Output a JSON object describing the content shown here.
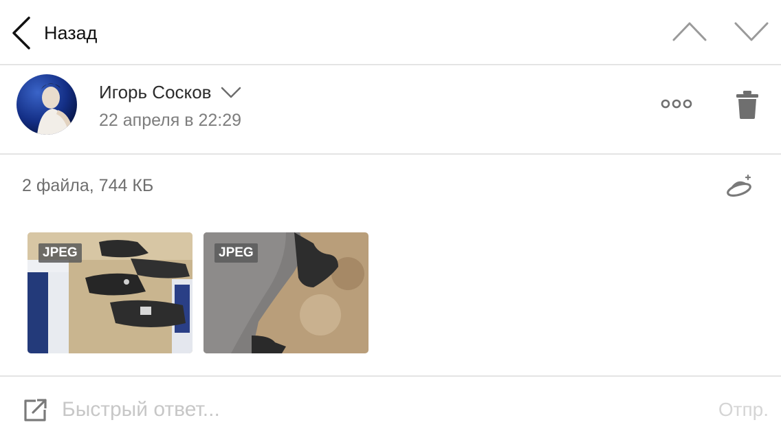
{
  "toolbar": {
    "back_label": "Назад",
    "icons": [
      "chevron-left-icon",
      "chevron-up-icon",
      "chevron-down-icon"
    ]
  },
  "message": {
    "sender_name": "Игорь Сосков",
    "date": "22 апреля в 22:29"
  },
  "attachments": {
    "summary": "2 файла, 744 КБ",
    "files": [
      {
        "type_badge": "JPEG"
      },
      {
        "type_badge": "JPEG"
      }
    ]
  },
  "reply": {
    "placeholder": "Быстрый ответ...",
    "send_label": "Отпр."
  },
  "colors": {
    "divider": "#e4e4e4",
    "icon_gray": "#7a7a7a",
    "secondary_text": "#7d7d7d",
    "placeholder": "#c7c7c7"
  }
}
